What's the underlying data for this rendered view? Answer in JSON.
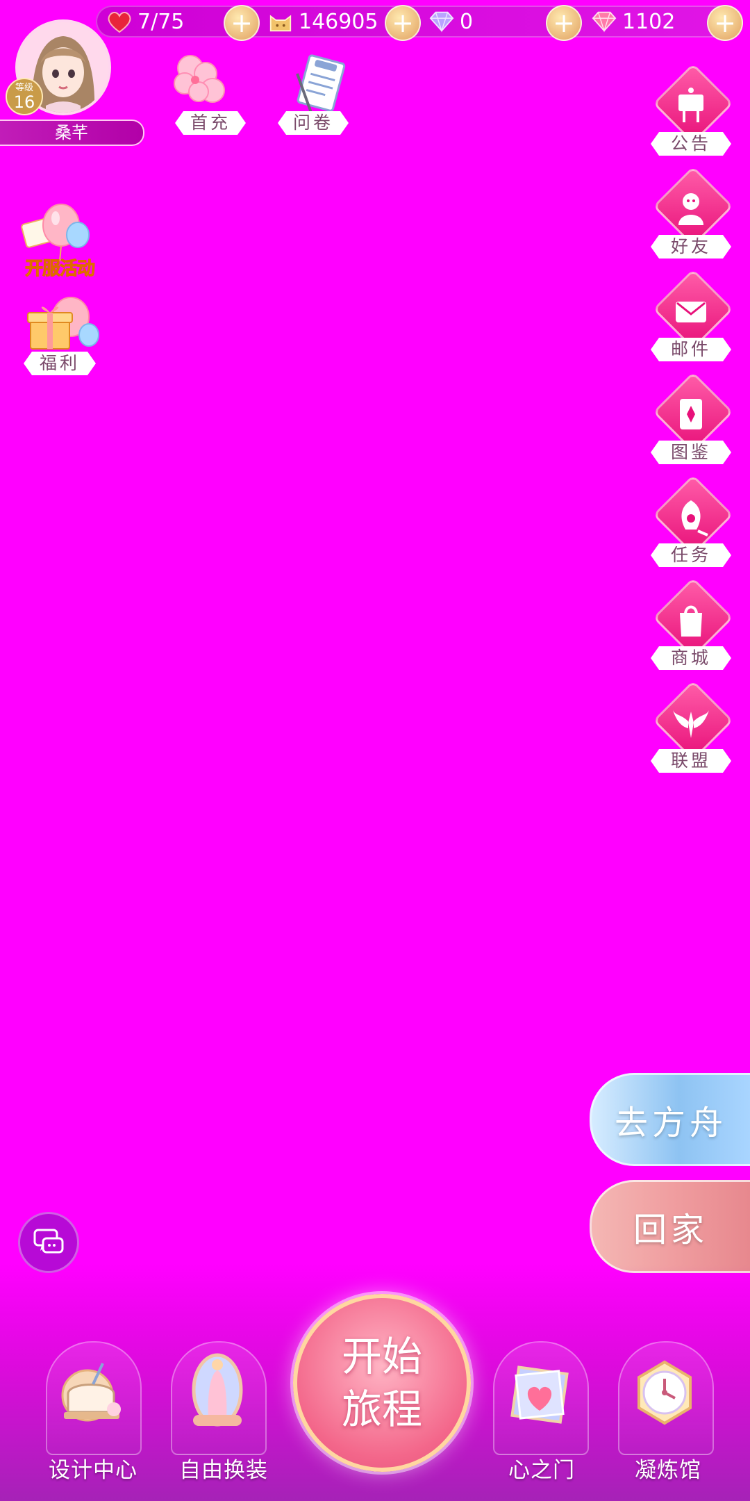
{
  "resources": [
    {
      "icon": "heart-icon",
      "value": "7/75",
      "color": "#e8243a"
    },
    {
      "icon": "cat-coin-icon",
      "value": "146905",
      "color": "#f2c36a"
    },
    {
      "icon": "diamond-blue-icon",
      "value": "0",
      "color": "#b9a4ff"
    },
    {
      "icon": "diamond-pink-icon",
      "value": "1102",
      "color": "#ff7aa8"
    }
  ],
  "player": {
    "level_label": "等级",
    "level": "16",
    "name": "桑芊"
  },
  "top_features": {
    "first_recharge": "首充",
    "survey": "问卷"
  },
  "left_features": {
    "open_event": "开服活动",
    "welfare": "福利"
  },
  "right_menu": [
    "公告",
    "好友",
    "邮件",
    "图鉴",
    "任务",
    "商城",
    "联盟"
  ],
  "travel": {
    "ark": "去方舟",
    "home": "回家"
  },
  "bottom_nav": {
    "design_center": "设计中心",
    "free_dress": "自由换装",
    "start_line1": "开始",
    "start_line2": "旅程",
    "heart_gate": "心之门",
    "refinery": "凝炼馆"
  },
  "colors": {
    "background": "#ff00ff",
    "accent": "#e8117a",
    "gold": "#c99b48"
  }
}
